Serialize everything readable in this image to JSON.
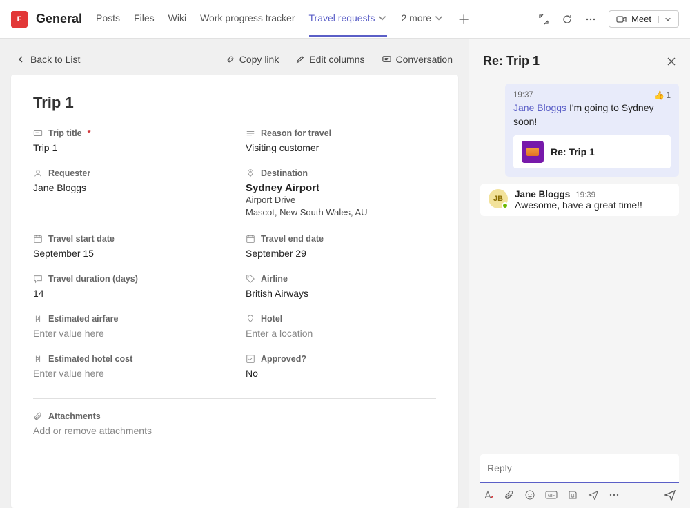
{
  "header": {
    "team_badge": "F",
    "channel": "General",
    "tabs": [
      "Posts",
      "Files",
      "Wiki",
      "Work progress tracker",
      "Travel requests"
    ],
    "active_tab_index": 4,
    "more_tabs_label": "2 more",
    "meet_label": "Meet"
  },
  "toolbar": {
    "back_label": "Back to List",
    "copy_link_label": "Copy link",
    "edit_columns_label": "Edit columns",
    "conversation_label": "Conversation"
  },
  "item": {
    "title": "Trip 1",
    "trip_title_label": "Trip title",
    "trip_title_value": "Trip 1",
    "reason_label": "Reason for travel",
    "reason_value": "Visiting customer",
    "requester_label": "Requester",
    "requester_value": "Jane Bloggs",
    "destination_label": "Destination",
    "destination_name": "Sydney Airport",
    "destination_line1": "Airport Drive",
    "destination_line2": "Mascot, New South Wales, AU",
    "start_label": "Travel start date",
    "start_value": "September 15",
    "end_label": "Travel end date",
    "end_value": "September 29",
    "duration_label": "Travel duration (days)",
    "duration_value": "14",
    "airline_label": "Airline",
    "airline_value": "British Airways",
    "airfare_label": "Estimated airfare",
    "airfare_placeholder": "Enter value here",
    "hotel_label": "Hotel",
    "hotel_placeholder": "Enter a location",
    "hotelcost_label": "Estimated hotel cost",
    "hotelcost_placeholder": "Enter value here",
    "approved_label": "Approved?",
    "approved_value": "No",
    "attachments_label": "Attachments",
    "attachments_placeholder": "Add or remove attachments"
  },
  "chat": {
    "title": "Re: Trip 1",
    "msg1": {
      "time": "19:37",
      "author": "Jane Bloggs",
      "text": "I'm going to Sydney soon!",
      "reaction_emoji": "👍",
      "reaction_count": "1",
      "attachment_title": "Re: Trip 1"
    },
    "msg2": {
      "avatar_initials": "JB",
      "author": "Jane Bloggs",
      "time": "19:39",
      "text": "Awesome, have a great time!!"
    },
    "reply_placeholder": "Reply"
  }
}
